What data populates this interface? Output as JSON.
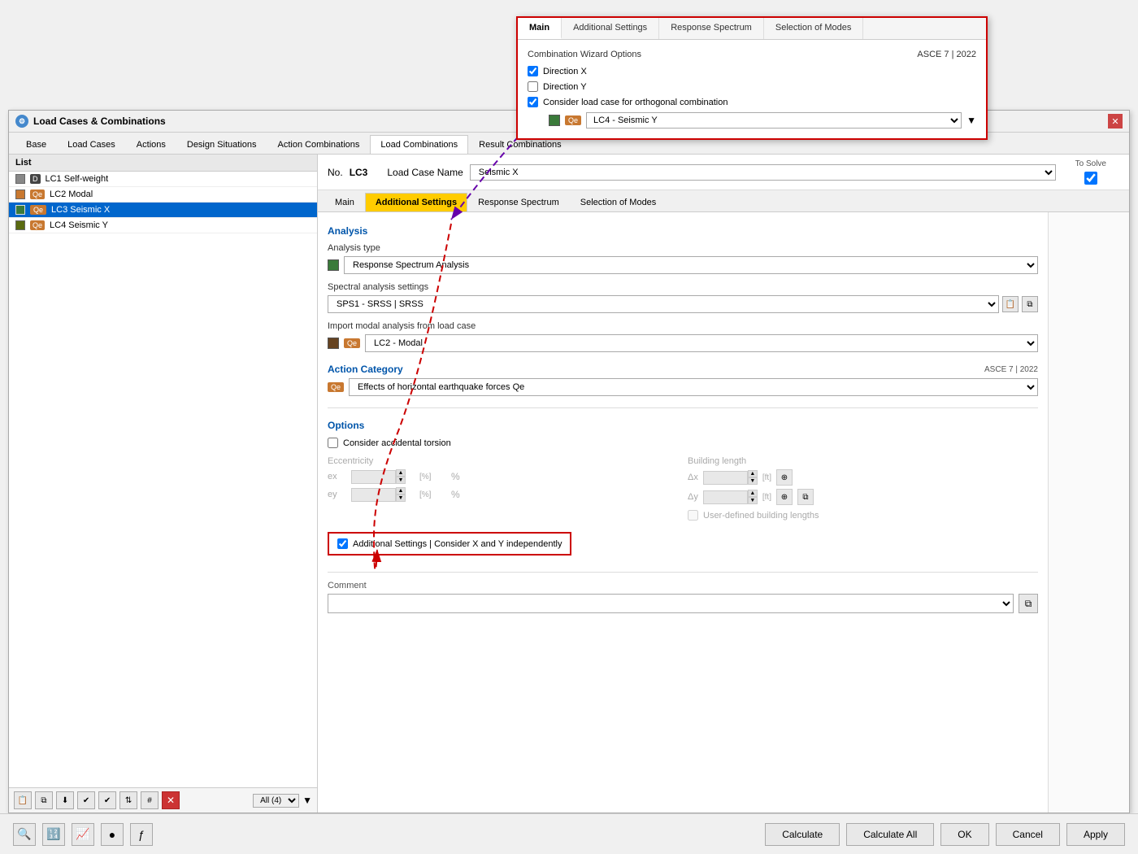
{
  "app": {
    "title": "Load Cases & Combinations"
  },
  "dialog_tabs": [
    "Base",
    "Load Cases",
    "Actions",
    "Design Situations",
    "Action Combinations",
    "Load Combinations",
    "Result Combinations"
  ],
  "list": {
    "header": "List",
    "items": [
      {
        "id": "D",
        "badge": "D",
        "badge_color": "#444444",
        "color": "#888888",
        "name": "LC1  Self-weight",
        "selected": false
      },
      {
        "id": "Qe",
        "badge": "Qe",
        "badge_color": "#c87830",
        "color": "#c87830",
        "name": "LC2  Modal",
        "selected": false
      },
      {
        "id": "Qe",
        "badge": "Qe",
        "badge_color": "#c87830",
        "color": "#3a7a3a",
        "name": "LC3  Seismic X",
        "selected": true
      },
      {
        "id": "Qe",
        "badge": "Qe",
        "badge_color": "#c87830",
        "color": "#5a6a10",
        "name": "LC4  Seismic Y",
        "selected": false
      }
    ],
    "count_label": "All (4)",
    "toolbar_buttons": [
      "new",
      "duplicate",
      "import",
      "check1",
      "check2",
      "sort",
      "number"
    ]
  },
  "lc_header": {
    "no_label": "No.",
    "no_value": "LC3",
    "name_label": "Load Case Name",
    "name_value": "Seismic X",
    "to_solve_label": "To Solve"
  },
  "detail_tabs": [
    "Main",
    "Additional Settings",
    "Response Spectrum",
    "Selection of Modes"
  ],
  "analysis": {
    "section_title": "Analysis",
    "type_label": "Analysis type",
    "type_value": "Response Spectrum Analysis",
    "spectral_label": "Spectral analysis settings",
    "spectral_value": "SPS1 - SRSS | SRSS",
    "import_label": "Import modal analysis from load case",
    "import_value": "LC2 - Modal"
  },
  "action_category": {
    "section_title": "Action Category",
    "asce_label": "ASCE 7 | 2022",
    "value": "Effects of horizontal earthquake forces",
    "badge": "Qe"
  },
  "options": {
    "section_title": "Options",
    "consider_torsion_label": "Consider accidental torsion",
    "eccentricity_label": "Eccentricity",
    "ex_label": "ex",
    "ey_label": "ey",
    "pct_unit": "[%]",
    "pct_symbol": "%",
    "building_length_label": "Building length",
    "dx_label": "Δx",
    "dy_label": "Δy",
    "ft_unit": "[ft]",
    "user_defined_label": "User-defined building lengths"
  },
  "highlight_checkbox": {
    "label": "Additional Settings | Consider X and Y independently",
    "checked": true
  },
  "comment": {
    "label": "Comment"
  },
  "floating_panel": {
    "tabs": [
      "Main",
      "Additional Settings",
      "Response Spectrum",
      "Selection of Modes"
    ],
    "active_tab": "Main",
    "combo_wizard_title": "Combination Wizard Options",
    "asce_label": "ASCE 7 | 2022",
    "direction_x_label": "Direction X",
    "direction_x_checked": true,
    "direction_y_label": "Direction Y",
    "direction_y_checked": false,
    "consider_orthogonal_label": "Consider load case for orthogonal combination",
    "consider_orthogonal_checked": true,
    "lc4_value": "LC4 - Seismic Y"
  },
  "bottom_buttons": {
    "calculate": "Calculate",
    "calculate_all": "Calculate All",
    "ok": "OK",
    "cancel": "Cancel",
    "apply": "Apply"
  },
  "icons": {
    "app_icon": "⚙",
    "new_icon": "➕",
    "duplicate_icon": "⧉",
    "import_icon": "⤓",
    "check_icon": "✔",
    "sort_icon": "⇅",
    "number_icon": "＃",
    "delete_icon": "✖",
    "copy_icon": "⧉",
    "small_icon": "📋",
    "search_icon": "🔍",
    "calc_icon": "🔢",
    "graph_icon": "📈",
    "settings_icon": "⚙",
    "func_icon": "ƒ"
  }
}
